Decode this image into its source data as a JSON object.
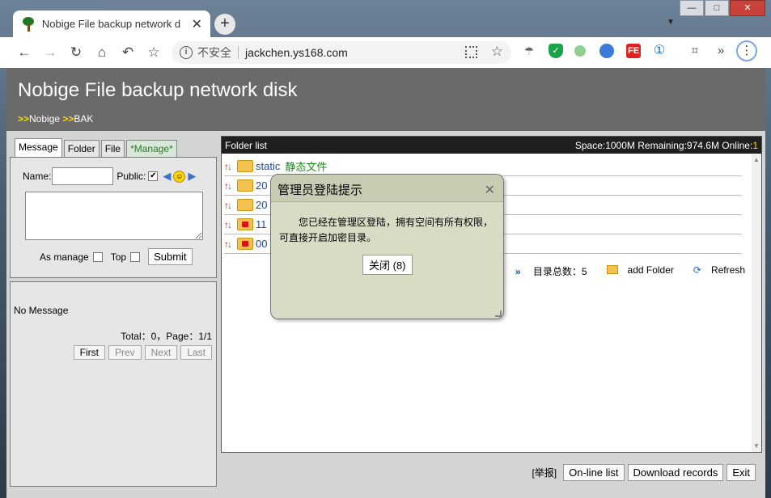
{
  "browser": {
    "tab_title": "Nobige File backup network d",
    "tab_close": "✕",
    "new_tab": "+",
    "tab_menu": "▼",
    "window_controls": {
      "minimize": "—",
      "maximize": "□",
      "close": "✕"
    },
    "nav": {
      "back": "←",
      "forward": "→",
      "reload": "↻",
      "home": "⌂",
      "undo": "↶",
      "bookmark": "☆"
    },
    "omnibox": {
      "info": "i",
      "security_label": "不安全",
      "url": "jackchen.ys168.com",
      "star": "☆"
    },
    "extensions": [
      "parachute-icon",
      "shield-icon",
      "green-dot-icon",
      "globe-icon",
      "fe-icon",
      "onepassword-icon",
      "crop-icon",
      "double-chevron-icon",
      "menu-dots-icon"
    ],
    "ext_labels": {
      "fe": "FE",
      "onepass": "①",
      "crop": "⌗",
      "more": "»",
      "menu": "⋮"
    }
  },
  "header": {
    "title": "Nobige File backup network disk",
    "crumb_sep": ">>",
    "crumbs": [
      "Nobige",
      "BAK"
    ]
  },
  "left": {
    "tabs": [
      "Message",
      "Folder",
      "File",
      "*Manage*"
    ],
    "name_label": "Name:",
    "public_label": "Public:",
    "public_check": "✔",
    "arrow_left": "◀",
    "arrow_right": "▶",
    "smiley": "☺",
    "as_manage_label": "As manage",
    "top_label": "Top",
    "submit_label": "Submit",
    "no_message": "No Message",
    "pager_info": "Total：0，Page：1/1",
    "pager": [
      "First",
      "Prev",
      "Next",
      "Last"
    ]
  },
  "folders": {
    "header_title": "Folder list",
    "space_info": "Space:1000M Remaining:974.6M Online:",
    "online_count": "1",
    "rows": [
      {
        "name": "static",
        "desc": "静态文件",
        "locked": false
      },
      {
        "name": "20",
        "desc": "",
        "locked": false
      },
      {
        "name": "20",
        "desc": "",
        "locked": false
      },
      {
        "name": "11",
        "desc": "",
        "locked": true
      },
      {
        "name": "00",
        "desc": "",
        "locked": true
      }
    ],
    "arrow_up": "↑",
    "arrow_down": "↓",
    "dir_count": "目录总数：5",
    "add_folder": "add Folder",
    "refresh": "Refresh",
    "chevrons": "»",
    "scroll_up": "▲",
    "scroll_down": "▼"
  },
  "footer": {
    "report": "[举报]",
    "buttons": [
      "On-line list",
      "Download records",
      "Exit"
    ]
  },
  "dialog": {
    "title": "管理员登陆提示",
    "close": "✕",
    "message": "您已经在管理区登陆，拥有空间有所有权限，可直接开启加密目录。",
    "button": "关闭 (8)"
  }
}
